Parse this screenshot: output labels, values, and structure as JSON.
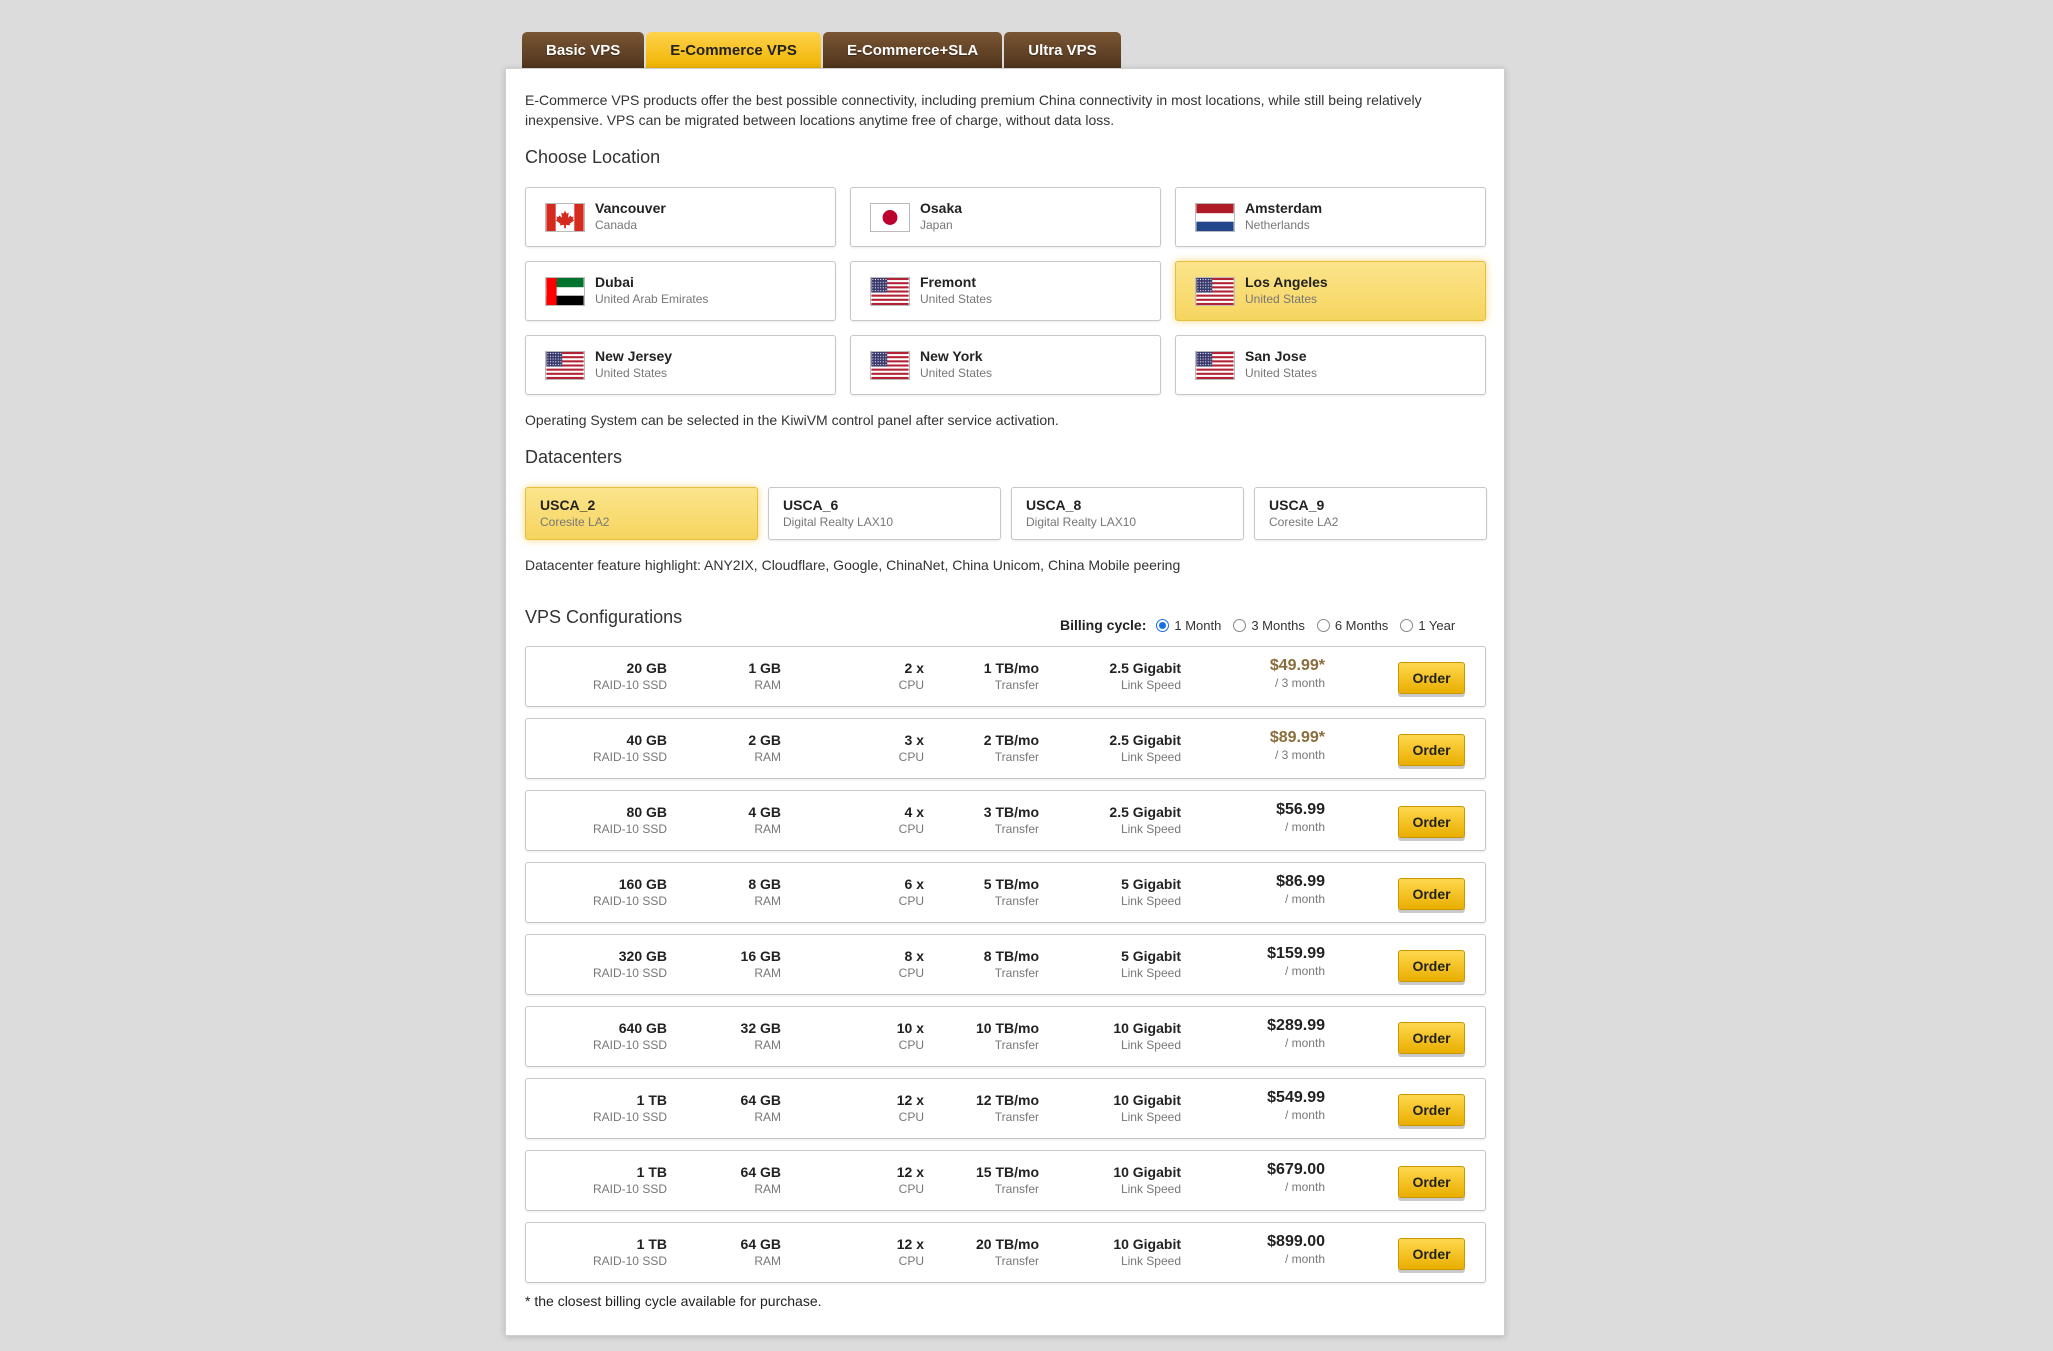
{
  "tabs": [
    {
      "label": "Basic VPS",
      "active": false
    },
    {
      "label": "E-Commerce VPS",
      "active": true
    },
    {
      "label": "E-Commerce+SLA",
      "active": false
    },
    {
      "label": "Ultra VPS",
      "active": false
    }
  ],
  "intro": "E-Commerce VPS products offer the best possible connectivity, including premium China connectivity in most locations, while still being relatively inexpensive. VPS can be migrated between locations anytime free of charge, without data loss.",
  "location_title": "Choose Location",
  "locations": [
    {
      "city": "Vancouver",
      "country": "Canada",
      "flag": "canada-flag-icon"
    },
    {
      "city": "Osaka",
      "country": "Japan",
      "flag": "japan-flag-icon"
    },
    {
      "city": "Amsterdam",
      "country": "Netherlands",
      "flag": "netherlands-flag-icon"
    },
    {
      "city": "Dubai",
      "country": "United Arab Emirates",
      "flag": "uae-flag-icon"
    },
    {
      "city": "Fremont",
      "country": "United States",
      "flag": "usa-flag-icon"
    },
    {
      "city": "Los Angeles",
      "country": "United States",
      "flag": "usa-flag-icon",
      "selected": true
    },
    {
      "city": "New Jersey",
      "country": "United States",
      "flag": "usa-flag-icon"
    },
    {
      "city": "New York",
      "country": "United States",
      "flag": "usa-flag-icon"
    },
    {
      "city": "San Jose",
      "country": "United States",
      "flag": "usa-flag-icon"
    }
  ],
  "os_note": "Operating System can be selected in the KiwiVM control panel after service activation.",
  "datacenter_title": "Datacenters",
  "datacenters": [
    {
      "name": "USCA_2",
      "sub": "Coresite LA2",
      "selected": true
    },
    {
      "name": "USCA_6",
      "sub": "Digital Realty LAX10"
    },
    {
      "name": "USCA_8",
      "sub": "Digital Realty LAX10"
    },
    {
      "name": "USCA_9",
      "sub": "Coresite LA2"
    }
  ],
  "dc_highlight": "Datacenter feature highlight: ANY2IX, Cloudflare, Google, ChinaNet, China Unicom, China Mobile peering",
  "config_title": "VPS Configurations",
  "billing": {
    "label": "Billing cycle:",
    "options": [
      "1 Month",
      "3 Months",
      "6 Months",
      "1 Year"
    ],
    "selected": "1 Month"
  },
  "plans": [
    {
      "disk": "20 GB",
      "disk_unit": "RAID-10 SSD",
      "ram": "1 GB",
      "ram_unit": "RAM",
      "cpu": "2 x",
      "cpu_unit": "CPU",
      "bw": "1 TB/mo",
      "bw_unit": "Transfer",
      "link": "2.5 Gigabit",
      "link_unit": "Link Speed",
      "price": "$49.99*",
      "period": "/ 3 month",
      "order": "Order"
    },
    {
      "disk": "40 GB",
      "disk_unit": "RAID-10 SSD",
      "ram": "2 GB",
      "ram_unit": "RAM",
      "cpu": "3 x",
      "cpu_unit": "CPU",
      "bw": "2 TB/mo",
      "bw_unit": "Transfer",
      "link": "2.5 Gigabit",
      "link_unit": "Link Speed",
      "price": "$89.99*",
      "period": "/ 3 month",
      "order": "Order"
    },
    {
      "disk": "80 GB",
      "disk_unit": "RAID-10 SSD",
      "ram": "4 GB",
      "ram_unit": "RAM",
      "cpu": "4 x",
      "cpu_unit": "CPU",
      "bw": "3 TB/mo",
      "bw_unit": "Transfer",
      "link": "2.5 Gigabit",
      "link_unit": "Link Speed",
      "price": "$56.99",
      "period": "/ month",
      "order": "Order"
    },
    {
      "disk": "160 GB",
      "disk_unit": "RAID-10 SSD",
      "ram": "8 GB",
      "ram_unit": "RAM",
      "cpu": "6 x",
      "cpu_unit": "CPU",
      "bw": "5 TB/mo",
      "bw_unit": "Transfer",
      "link": "5 Gigabit",
      "link_unit": "Link Speed",
      "price": "$86.99",
      "period": "/ month",
      "order": "Order"
    },
    {
      "disk": "320 GB",
      "disk_unit": "RAID-10 SSD",
      "ram": "16 GB",
      "ram_unit": "RAM",
      "cpu": "8 x",
      "cpu_unit": "CPU",
      "bw": "8 TB/mo",
      "bw_unit": "Transfer",
      "link": "5 Gigabit",
      "link_unit": "Link Speed",
      "price": "$159.99",
      "period": "/ month",
      "order": "Order"
    },
    {
      "disk": "640 GB",
      "disk_unit": "RAID-10 SSD",
      "ram": "32 GB",
      "ram_unit": "RAM",
      "cpu": "10 x",
      "cpu_unit": "CPU",
      "bw": "10 TB/mo",
      "bw_unit": "Transfer",
      "link": "10 Gigabit",
      "link_unit": "Link Speed",
      "price": "$289.99",
      "period": "/ month",
      "order": "Order"
    },
    {
      "disk": "1 TB",
      "disk_unit": "RAID-10 SSD",
      "ram": "64 GB",
      "ram_unit": "RAM",
      "cpu": "12 x",
      "cpu_unit": "CPU",
      "bw": "12 TB/mo",
      "bw_unit": "Transfer",
      "link": "10 Gigabit",
      "link_unit": "Link Speed",
      "price": "$549.99",
      "period": "/ month",
      "order": "Order"
    },
    {
      "disk": "1 TB",
      "disk_unit": "RAID-10 SSD",
      "ram": "64 GB",
      "ram_unit": "RAM",
      "cpu": "12 x",
      "cpu_unit": "CPU",
      "bw": "15 TB/mo",
      "bw_unit": "Transfer",
      "link": "10 Gigabit",
      "link_unit": "Link Speed",
      "price": "$679.00",
      "period": "/ month",
      "order": "Order"
    },
    {
      "disk": "1 TB",
      "disk_unit": "RAID-10 SSD",
      "ram": "64 GB",
      "ram_unit": "RAM",
      "cpu": "12 x",
      "cpu_unit": "CPU",
      "bw": "20 TB/mo",
      "bw_unit": "Transfer",
      "link": "10 Gigabit",
      "link_unit": "Link Speed",
      "price": "$899.00",
      "period": "/ month",
      "order": "Order"
    }
  ],
  "footnote": "* the closest billing cycle available for purchase.",
  "colors": {
    "accent": "#f6d55f",
    "tab_brown": "#5e3f22",
    "order_gold": "#f2bf12"
  }
}
